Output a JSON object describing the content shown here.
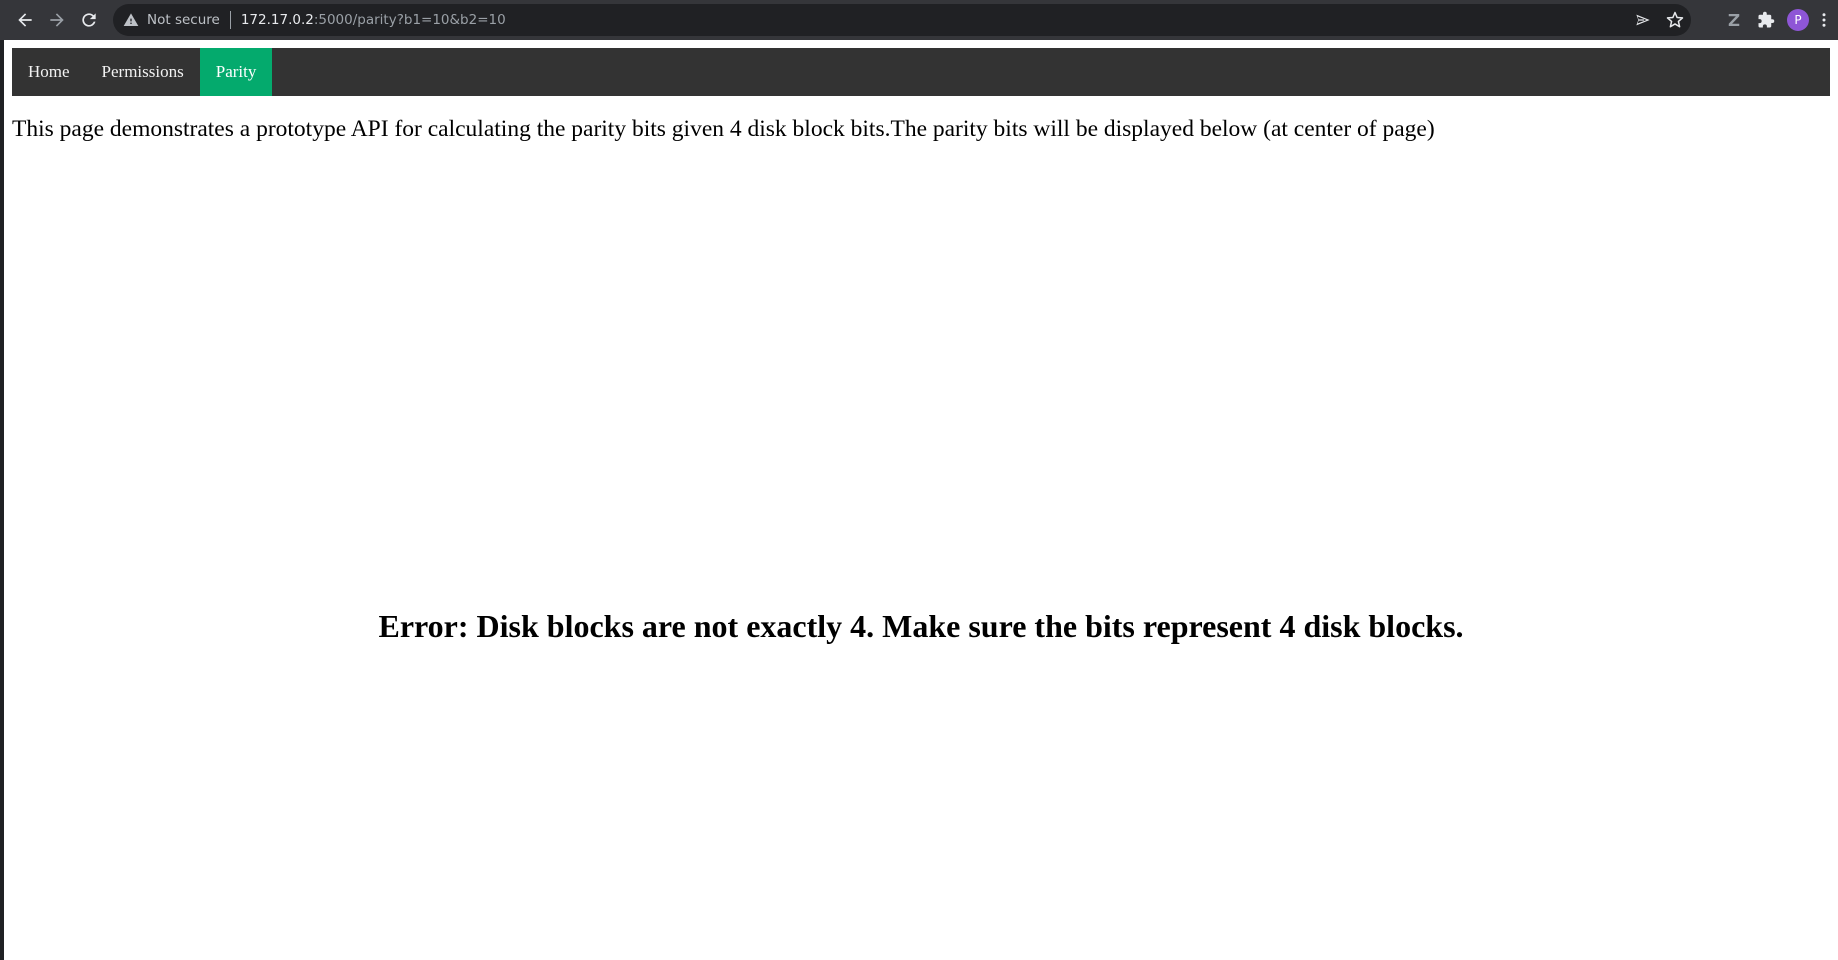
{
  "browser": {
    "security_label": "Not secure",
    "url_host": "172.17.0.2",
    "url_rest": ":5000/parity?b1=10&b2=10",
    "avatar_initial": "P",
    "colors": {
      "toolbar": "#35363a",
      "omnibox": "#202124",
      "avatar": "#8e56d6"
    }
  },
  "nav": {
    "items": [
      {
        "label": "Home",
        "active": false
      },
      {
        "label": "Permissions",
        "active": false
      },
      {
        "label": "Parity",
        "active": true
      }
    ],
    "colors": {
      "bar": "#333333",
      "active": "#04aa6d"
    }
  },
  "page": {
    "intro_text": "This page demonstrates a prototype API for calculating the parity bits given 4 disk block bits.The parity bits will be displayed below (at center of page)",
    "result_text": "Error: Disk blocks are not exactly 4. Make sure the bits represent 4 disk blocks."
  },
  "icons": {
    "back": "arrow-left-icon",
    "forward": "arrow-right-icon",
    "reload": "reload-icon",
    "warning": "warning-triangle-icon",
    "send": "send-icon",
    "bookmark": "star-icon",
    "extension_z": "z-extension-icon",
    "extensions": "puzzle-icon",
    "menu": "kebab-menu-icon"
  }
}
